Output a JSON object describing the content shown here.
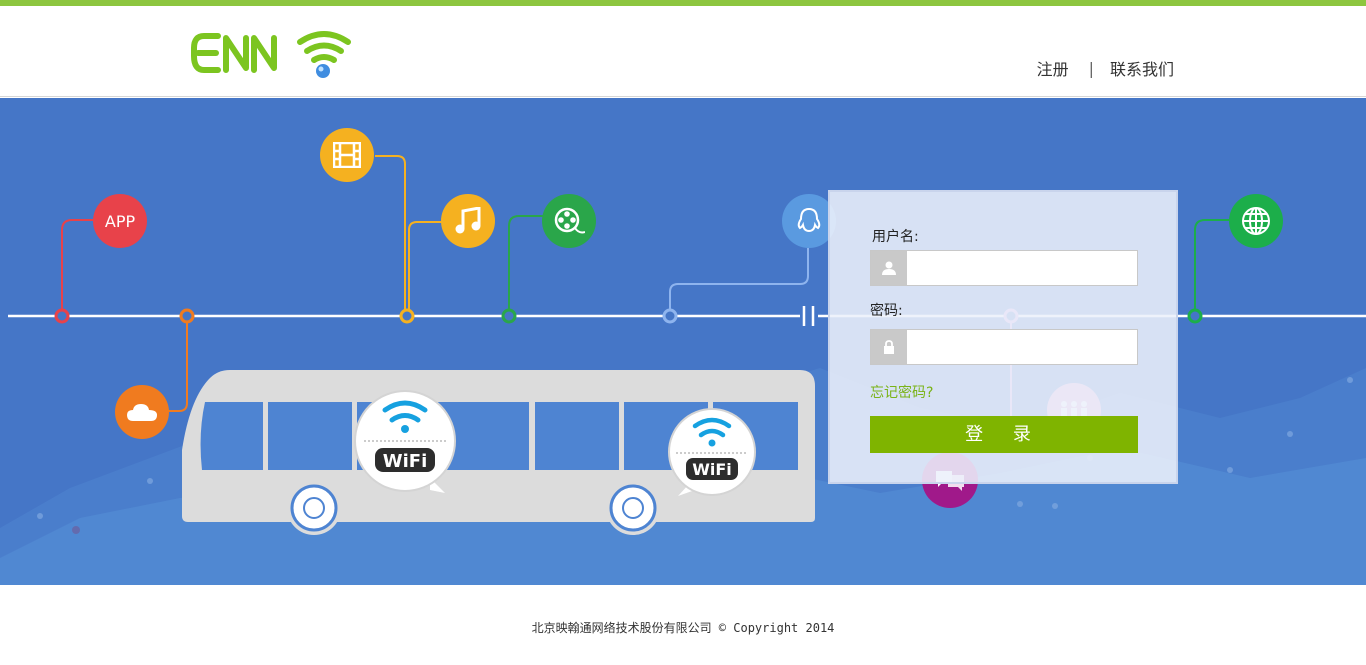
{
  "header": {
    "logo_text": "ENN",
    "nav": {
      "register": "注册",
      "separator": "|",
      "contact": "联系我们"
    }
  },
  "banner": {
    "icons": [
      {
        "name": "app",
        "label": "APP",
        "color": "#e8424a"
      },
      {
        "name": "cloud",
        "color": "#f07b1f"
      },
      {
        "name": "film",
        "color": "#f5b120"
      },
      {
        "name": "music",
        "color": "#f5b120"
      },
      {
        "name": "video-reel",
        "color": "#2aa64a"
      },
      {
        "name": "qq",
        "color": "#5a9ae0"
      },
      {
        "name": "group",
        "color": "#e7a6d6"
      },
      {
        "name": "chat",
        "color": "#a0198a"
      },
      {
        "name": "globe",
        "color": "#1cae4a"
      }
    ],
    "wifi_badge_text": "WiFi"
  },
  "login": {
    "username_label": "用户名:",
    "password_label": "密码:",
    "forgot": "忘记密码?",
    "submit": "登 录",
    "accent": "#7fb400"
  },
  "footer": {
    "copyright": "北京映翰通网络技术股份有限公司 © Copyright 2014"
  }
}
